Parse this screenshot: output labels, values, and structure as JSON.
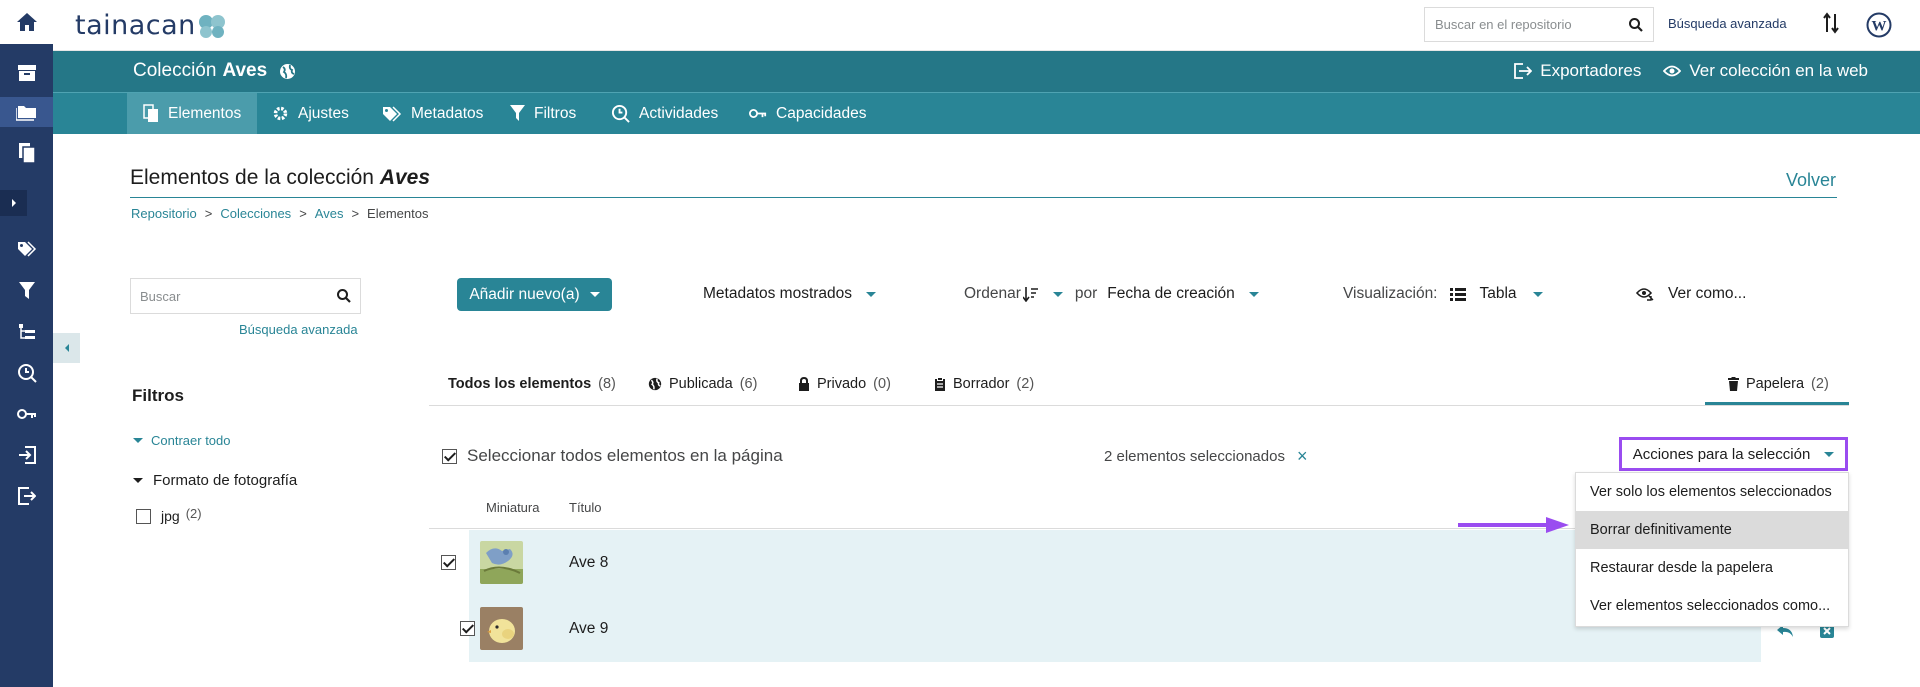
{
  "topbar": {
    "logo_text": "tainacan",
    "search_placeholder": "Buscar en el repositorio",
    "advanced_search": "Búsqueda avanzada"
  },
  "collection": {
    "prefix": "Colección",
    "name": "Aves",
    "exporters": "Exportadores",
    "view_web": "Ver colección en la web"
  },
  "tabs": [
    {
      "label": "Elementos",
      "icon": "items-icon",
      "active": true
    },
    {
      "label": "Ajustes",
      "icon": "gear-icon"
    },
    {
      "label": "Metadatos",
      "icon": "tags-icon"
    },
    {
      "label": "Filtros",
      "icon": "filter-icon"
    },
    {
      "label": "Actividades",
      "icon": "activities-icon"
    },
    {
      "label": "Capacidades",
      "icon": "key-icon"
    }
  ],
  "page": {
    "title_prefix": "Elementos de la colección",
    "title_name": "Aves",
    "back": "Volver",
    "breadcrumb": [
      "Repositorio",
      "Colecciones",
      "Aves",
      "Elementos"
    ],
    "breadcrumb_sep": ">"
  },
  "left": {
    "search_placeholder": "Buscar",
    "advanced_search": "Búsqueda avanzada",
    "filters_title": "Filtros",
    "collapse_all": "Contraer todo",
    "facet_name": "Formato de fotografía",
    "facet_option": "jpg",
    "facet_count": "(2)"
  },
  "toolbar": {
    "add_new": "Añadir nuevo(a)",
    "shown_metadata": "Metadatos mostrados",
    "sort_label": "Ordenar",
    "by": "por",
    "sort_field": "Fecha de creación",
    "view_label": "Visualización:",
    "view_mode": "Tabla",
    "view_as": "Ver como..."
  },
  "status_tabs": [
    {
      "label": "Todos los elementos",
      "count": "(8)",
      "bold": true
    },
    {
      "label": "Publicada",
      "count": "(6)",
      "icon": "globe-icon"
    },
    {
      "label": "Privado",
      "count": "(0)",
      "icon": "lock-icon"
    },
    {
      "label": "Borrador",
      "count": "(2)",
      "icon": "clipboard-icon"
    },
    {
      "label": "Papelera",
      "count": "(2)",
      "icon": "trash-icon",
      "active": true
    }
  ],
  "selection": {
    "select_all": "Seleccionar todos elementos en la página",
    "selected_count": "2 elementos seleccionados",
    "clear": "×",
    "actions": "Acciones para la selección"
  },
  "dropdown": [
    "Ver solo los elementos seleccionados",
    "Borrar definitivamente",
    "Restaurar desde la papelera",
    "Ver elementos seleccionados como..."
  ],
  "table": {
    "col_thumb": "Miniatura",
    "col_title": "Título",
    "rows": [
      {
        "title": "Ave 8",
        "checked": true
      },
      {
        "title": "Ave 9",
        "checked": true
      }
    ]
  },
  "colors": {
    "sidebar": "#243b66",
    "accent": "#298596",
    "header": "#257787",
    "highlight": "#9a4cf0",
    "row_selected": "#e5f2f5"
  }
}
